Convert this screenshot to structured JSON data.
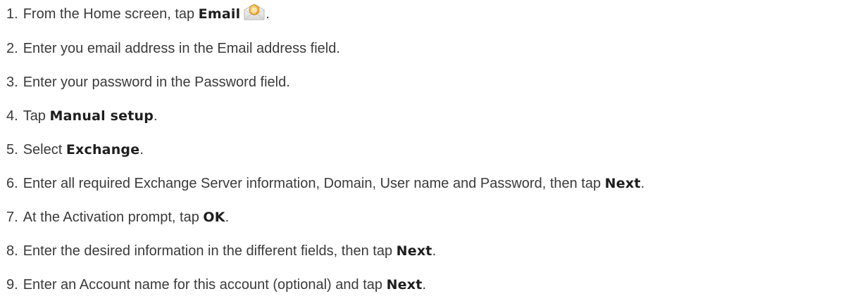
{
  "steps": [
    {
      "num": "1.",
      "pre": "From the Home screen, tap ",
      "bold": "Email",
      "post": ".",
      "icon": "email-envelope-icon"
    },
    {
      "num": "2.",
      "pre": "Enter you email address in the Email address field.",
      "bold": "",
      "post": ""
    },
    {
      "num": "3.",
      "pre": "Enter your password in the Password field.",
      "bold": "",
      "post": ""
    },
    {
      "num": "4.",
      "pre": "Tap ",
      "bold": "Manual setup",
      "post": "."
    },
    {
      "num": "5.",
      "pre": "Select ",
      "bold": "Exchange",
      "post": "."
    },
    {
      "num": "6.",
      "pre": "Enter all required Exchange Server information, Domain, User name and Password, then tap ",
      "bold": "Next",
      "post": "."
    },
    {
      "num": "7.",
      "pre": "At the Activation prompt, tap ",
      "bold": "OK",
      "post": "."
    },
    {
      "num": "8.",
      "pre": "Enter the desired information in the different fields, then tap ",
      "bold": "Next",
      "post": "."
    },
    {
      "num": "9.",
      "pre": "Enter an Account name for this account (optional) and tap ",
      "bold": "Next",
      "post": "."
    }
  ],
  "colors": {
    "text": "#3a3a3a",
    "emphasis": "#1e1e1e",
    "icon_envelope": "#f0f0f0",
    "icon_badge": "#f2b233"
  }
}
